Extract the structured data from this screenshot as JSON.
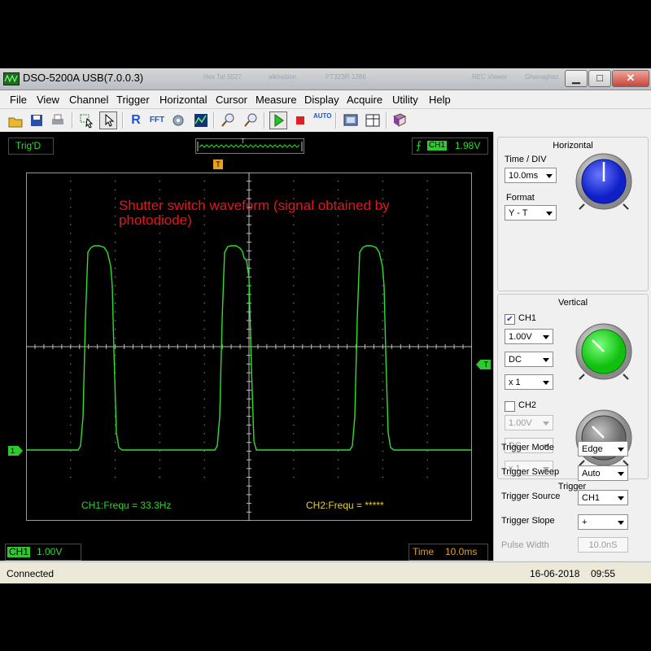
{
  "window": {
    "title": "DSO-5200A USB(7.0.0.3)",
    "bg_labels": [
      "Hex Tat 5527",
      "alkhattion",
      "PT3Z3R 1286",
      "REC Viewer",
      "Ghanaghaz"
    ],
    "buttons": {
      "minimize": "▁",
      "maximize": "□",
      "close": "✕"
    }
  },
  "menu": [
    "File",
    "View",
    "Channel",
    "Trigger",
    "Horizontal",
    "Cursor",
    "Measure",
    "Display",
    "Acquire",
    "Utility",
    "Help"
  ],
  "toolbar": {
    "icons": [
      "open-folder-icon",
      "save-icon",
      "print-icon",
      "select-zoom-icon",
      "pointer-icon",
      "reset-icon",
      "fft-icon",
      "probe-icon",
      "math-icon",
      "zoom-in-icon",
      "zoom-out-icon",
      "run-icon",
      "stop-icon",
      "auto-icon",
      "screenshot-icon",
      "layout-icon",
      "help-book-icon"
    ],
    "labels": {
      "reset": "R",
      "fft": "FFT",
      "auto": "AUTO"
    }
  },
  "scope": {
    "trig_status": "Trig'D",
    "trigger_channel": "CH1",
    "trigger_level": "1.98V",
    "trigger_marker": "T",
    "annotation": "Shutter switch waveform (signal obtained by photodiode)",
    "ch1_marker": "1",
    "trigger_level_marker": "T",
    "measure_ch1": "CH1:Frequ = 33.3Hz",
    "measure_ch2": "CH2:Frequ = *****",
    "ch1_label": "CH1",
    "ch1_scale": "1.00V",
    "time_label": "Time",
    "time_value": "10.0ms"
  },
  "colors": {
    "trace": "#2ee02e",
    "grid": "#9a9a9a",
    "annotation": "#e8141c",
    "measure_ch1": "#29d829",
    "measure_ch2": "#e8d228",
    "time_text": "#e8a020"
  },
  "horizontal": {
    "title": "Horizontal",
    "time_div_label": "Time / DIV",
    "time_div": "10.0ms",
    "format_label": "Format",
    "format": "Y - T"
  },
  "vertical": {
    "title": "Vertical",
    "ch1": {
      "label": "CH1",
      "checked": true,
      "volts": "1.00V",
      "coupling": "DC",
      "probe": "x 1"
    },
    "ch2": {
      "label": "CH2",
      "checked": false,
      "volts": "1.00V",
      "coupling": "DC",
      "probe": "x 1"
    }
  },
  "trigger": {
    "title": "Trigger",
    "mode_label": "Trigger Mode",
    "mode": "Edge",
    "sweep_label": "Trigger Sweep",
    "sweep": "Auto",
    "source_label": "Trigger Source",
    "source": "CH1",
    "slope_label": "Trigger Slope",
    "slope": "+",
    "pulse_label": "Pulse Width",
    "pulse": "10.0nS"
  },
  "status": {
    "connection": "Connected",
    "date": "16-06-2018",
    "time": "09:55"
  }
}
